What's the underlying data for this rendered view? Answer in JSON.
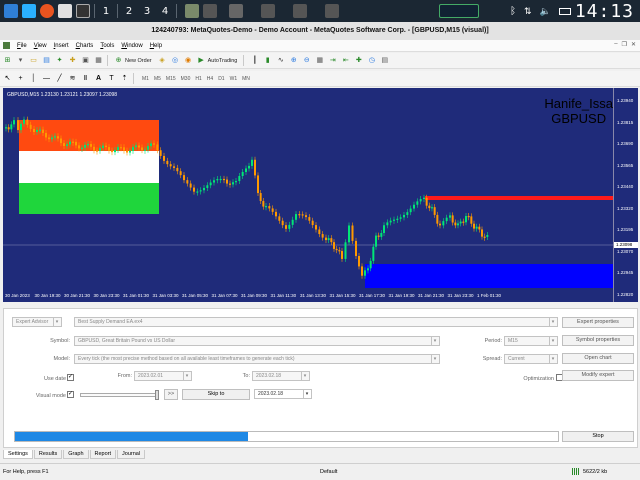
{
  "taskbar": {
    "workspaces": [
      "1",
      "2",
      "3",
      "4"
    ],
    "clock": "14:13"
  },
  "window": {
    "title": "124240793: MetaQuotes-Demo - Demo Account - MetaQuotes Software Corp. - [GBPUSD,M15 (visual)]"
  },
  "menu": {
    "items": [
      "File",
      "View",
      "Insert",
      "Charts",
      "Tools",
      "Window",
      "Help"
    ]
  },
  "toolbar": {
    "new_order": "New Order",
    "auto_trading": "AutoTrading",
    "timeframes": [
      "M1",
      "M5",
      "M15",
      "M30",
      "H1",
      "H4",
      "D1",
      "W1",
      "MN"
    ]
  },
  "chart": {
    "info": "GBPUSD,M15  1.23130 1.23121 1.23097 1.23098",
    "watermark_name": "Hanife_Issa",
    "watermark_symbol": "GBPUSD",
    "price_labels": [
      "1.23940",
      "1.23815",
      "1.23690",
      "1.23565",
      "1.23440",
      "1.23320",
      "1.23195",
      "1.23070",
      "1.22945",
      "1.22820"
    ],
    "current_price": "1.23098",
    "time_labels": [
      "30 Jan 2023",
      "30 Jan 19:30",
      "30 Jan 21:30",
      "30 Jan 23:30",
      "31 Jan 01:30",
      "31 Jan 03:30",
      "31 Jan 05:30",
      "31 Jan 07:30",
      "31 Jan 09:30",
      "31 Jan 11:30",
      "31 Jan 13:30",
      "31 Jan 15:30",
      "31 Jan 17:30",
      "31 Jan 19:30",
      "31 Jan 21:30",
      "31 Jan 23:30",
      "1 Feb 01:30"
    ],
    "colors": {
      "background": "#1f2b7a",
      "bull": "#ff9900",
      "bear": "#00e676",
      "supply_zone": "#ff1a1a",
      "demand_zone": "#0000ff"
    }
  },
  "tester": {
    "expert_type": "Expert Advisor",
    "expert": "Best Supply Demand EA.ex4",
    "symbol_label": "Symbol:",
    "symbol": "GBPUSD, Great Britain Pound vs US Dollar",
    "model_label": "Model:",
    "model": "Every tick (the most precise method based on all available least timeframes to generate each tick)",
    "use_date_label": "Use date",
    "from_label": "From:",
    "from": "2023.02.01",
    "to_label": "To:",
    "to": "2023.02.18",
    "visual_mode_label": "Visual mode",
    "skip_button": "Skip to",
    "skip_date": "2023.02.18",
    "speed_button": ">>",
    "period_label": "Period:",
    "period": "M15",
    "spread_label": "Spread:",
    "spread": "Current",
    "optimization_label": "Optimization",
    "buttons": {
      "expert_properties": "Expert properties",
      "symbol_properties": "Symbol properties",
      "open_chart": "Open chart",
      "modify_expert": "Modify expert",
      "stop": "Stop"
    },
    "progress": 0.43
  },
  "tabs": [
    "Settings",
    "Results",
    "Graph",
    "Report",
    "Journal"
  ],
  "status": {
    "help": "For Help, press F1",
    "profile": "Default",
    "memory": "5622/2 kb"
  }
}
